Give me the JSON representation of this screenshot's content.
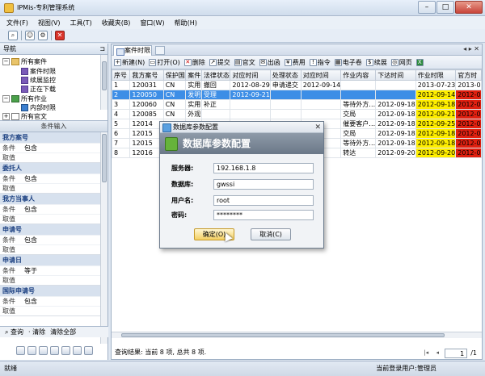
{
  "window": {
    "title": "IPMis-专利管理系统"
  },
  "menu": [
    "文件(F)",
    "视图(V)",
    "工具(T)",
    "收藏夹(B)",
    "窗口(W)",
    "帮助(H)"
  ],
  "nav": {
    "title": "导航",
    "tree": {
      "all_cases": "所有案件",
      "case_deadline": "案件时限",
      "renewal_monitor": "续展监控",
      "downloading": "正在下载",
      "all_tasks": "所有作业",
      "internal_deadline": "内部时限",
      "all_official": "所有官文"
    }
  },
  "conditions": {
    "title": "条件输入",
    "groups": [
      {
        "name": "我方案号",
        "rows": [
          {
            "k": "条件",
            "v": "包含"
          },
          {
            "k": "取值",
            "v": ""
          }
        ]
      },
      {
        "name": "委托人",
        "rows": [
          {
            "k": "条件",
            "v": "包含"
          },
          {
            "k": "取值",
            "v": ""
          }
        ]
      },
      {
        "name": "我方当事人",
        "rows": [
          {
            "k": "条件",
            "v": "包含"
          },
          {
            "k": "取值",
            "v": ""
          }
        ]
      },
      {
        "name": "申请号",
        "rows": [
          {
            "k": "条件",
            "v": "包含"
          },
          {
            "k": "取值",
            "v": ""
          }
        ]
      },
      {
        "name": "申请日",
        "rows": [
          {
            "k": "条件",
            "v": "等于"
          },
          {
            "k": "取值",
            "v": ""
          }
        ]
      },
      {
        "name": "国际申请号",
        "rows": [
          {
            "k": "条件",
            "v": "包含"
          },
          {
            "k": "取值",
            "v": ""
          }
        ]
      }
    ],
    "query": "查询",
    "clear": "清除",
    "clear_all": "清除全部"
  },
  "tab": {
    "label": "案件时限"
  },
  "toolbar": [
    "新建(N)",
    "打开(O)",
    "删除",
    "提交",
    "官文",
    "出函",
    "费用",
    "指令",
    "电子卷",
    "续展",
    "网页"
  ],
  "table": {
    "columns": [
      "序号",
      "我方案号",
      "保护国",
      "案件",
      "法律状态",
      "对应时间",
      "处理状态",
      "对应时间",
      "作业内容",
      "下达时间",
      "作业时限",
      "官方时"
    ],
    "rows": [
      [
        "1",
        "120031",
        "CN",
        "实用",
        "撤回",
        "2012-08-29",
        "申请递交",
        "2012-09-14",
        "",
        "",
        "2013-07-23",
        "2013-0"
      ],
      [
        "2",
        "120050",
        "CN",
        "发明",
        "受理",
        "2012-09-21",
        "",
        "",
        "",
        "",
        "2012-09-14",
        "2012-0"
      ],
      [
        "3",
        "120060",
        "CN",
        "实用",
        "补正",
        "",
        "",
        "",
        "等待外方…",
        "2012-09-18",
        "2012-09-18",
        "2012-0"
      ],
      [
        "4",
        "120085",
        "CN",
        "外观",
        "",
        "",
        "",
        "",
        "交局",
        "2012-09-18",
        "2012-09-21",
        "2012-0"
      ],
      [
        "5",
        "12014",
        "",
        "",
        "",
        "",
        "",
        "",
        "催要客户…",
        "2012-09-18",
        "2012-09-25",
        "2012-0"
      ],
      [
        "6",
        "12015",
        "",
        "",
        "",
        "",
        "",
        "",
        "交局",
        "2012-09-18",
        "2012-09-18",
        "2012-0"
      ],
      [
        "7",
        "12015",
        "",
        "",
        "",
        "",
        "",
        "",
        "等待外方…",
        "2012-09-18",
        "2012-09-18",
        "2012-0"
      ],
      [
        "8",
        "12016",
        "",
        "",
        "",
        "",
        "",
        "",
        "转达",
        "2012-09-20",
        "2012-09-20",
        "2012-0"
      ]
    ]
  },
  "status": {
    "query_result": "查询结果: 当前 8 项, 总共 8 项.",
    "page": "1",
    "total_pages": "/1"
  },
  "footer": {
    "left": "就绪",
    "right": "当前登录用户:管理员"
  },
  "dialog": {
    "title": "数据库参数配置",
    "banner": "数据库参数配置",
    "server_label": "服务器:",
    "server": "192.168.1.8",
    "db_label": "数据库:",
    "db": "gwssi",
    "user_label": "用户名:",
    "user": "root",
    "pwd_label": "密码:",
    "pwd": "********",
    "ok": "确定(O)",
    "cancel": "取消(C)"
  }
}
